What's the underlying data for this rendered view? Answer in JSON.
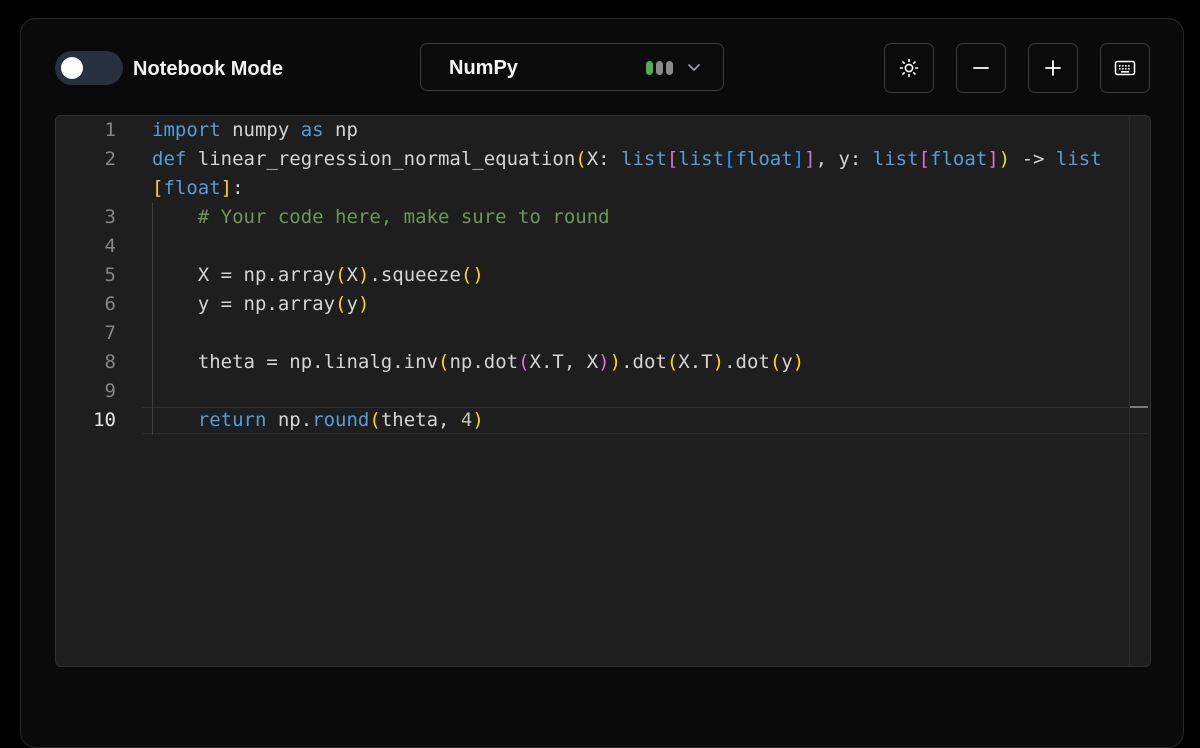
{
  "toolbar": {
    "notebook_mode_label": "Notebook Mode",
    "notebook_mode_enabled": false,
    "language_selected": "NumPy",
    "status_pill_colors": [
      "#4caf50",
      "#8a8a8a",
      "#8a8a8a"
    ],
    "buttons": {
      "theme_icon": "sun-icon",
      "zoom_out_icon": "minus-icon",
      "zoom_in_icon": "plus-icon",
      "keyboard_icon": "keyboard-icon"
    }
  },
  "editor": {
    "active_line": "10",
    "line_numbers": [
      "1",
      "2",
      "",
      "3",
      "4",
      "5",
      "6",
      "7",
      "8",
      "9",
      "10"
    ],
    "lines": [
      "import numpy as np",
      "def linear_regression_normal_equation(X: list[list[float]], y: list[float]) -> list",
      "[float]:",
      "    # Your code here, make sure to round",
      "",
      "    X = np.array(X).squeeze()",
      "    y = np.array(y)",
      "",
      "    theta = np.linalg.inv(np.dot(X.T, X)).dot(X.T).dot(y)",
      "",
      "    return np.round(theta, 4)"
    ]
  },
  "colors": {
    "keyword": "#569cd6",
    "comment": "#6a9955",
    "number": "#b5cea8",
    "bracket_level_1": "#ffd700",
    "bracket_level_2": "#da70d6",
    "bracket_level_3": "#179fff"
  }
}
